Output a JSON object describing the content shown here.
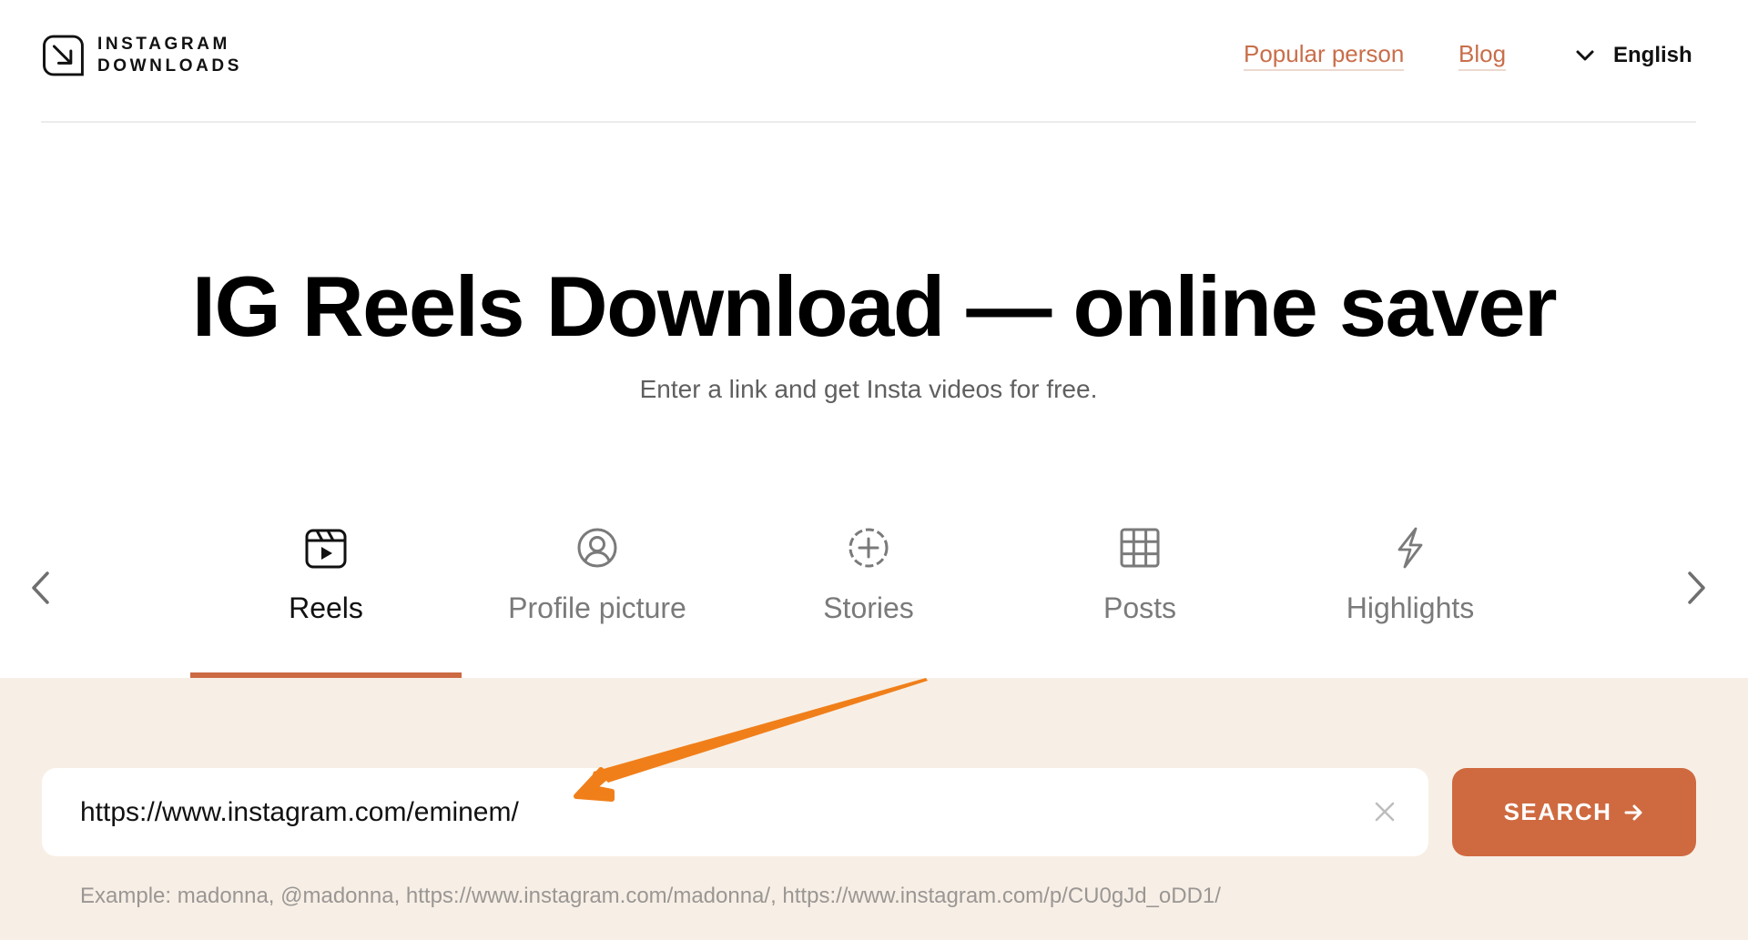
{
  "header": {
    "logo_line1": "INSTAGRAM",
    "logo_line2": "DOWNLOADS",
    "logo_icon": "arrow-down-right-box-icon",
    "nav": [
      {
        "label": "Popular person"
      },
      {
        "label": "Blog"
      }
    ],
    "language": {
      "label": "English",
      "icon": "chevron-down-icon"
    }
  },
  "hero": {
    "title": "IG Reels Download — online saver",
    "subtitle": "Enter a link and get Insta videos for free."
  },
  "tabs": {
    "prev_icon": "chevron-left-icon",
    "next_icon": "chevron-right-icon",
    "active_index": 0,
    "items": [
      {
        "label": "Reels",
        "icon": "reels-icon"
      },
      {
        "label": "Profile picture",
        "icon": "profile-icon"
      },
      {
        "label": "Stories",
        "icon": "stories-icon"
      },
      {
        "label": "Posts",
        "icon": "grid-icon"
      },
      {
        "label": "Highlights",
        "icon": "lightning-icon"
      }
    ]
  },
  "search": {
    "value": "https://www.instagram.com/eminem/",
    "clear_icon": "close-icon",
    "button_label": "SEARCH",
    "button_icon": "arrow-right-icon",
    "example": "Example: madonna, @madonna, https://www.instagram.com/madonna/, https://www.instagram.com/p/CU0gJd_oDD1/"
  },
  "annotation": {
    "type": "arrow",
    "color": "#f07f1a",
    "points_to": "search-input"
  },
  "colors": {
    "accent": "#cf6a40",
    "link": "#c96e4a",
    "search_area_bg": "#f7efe6"
  }
}
